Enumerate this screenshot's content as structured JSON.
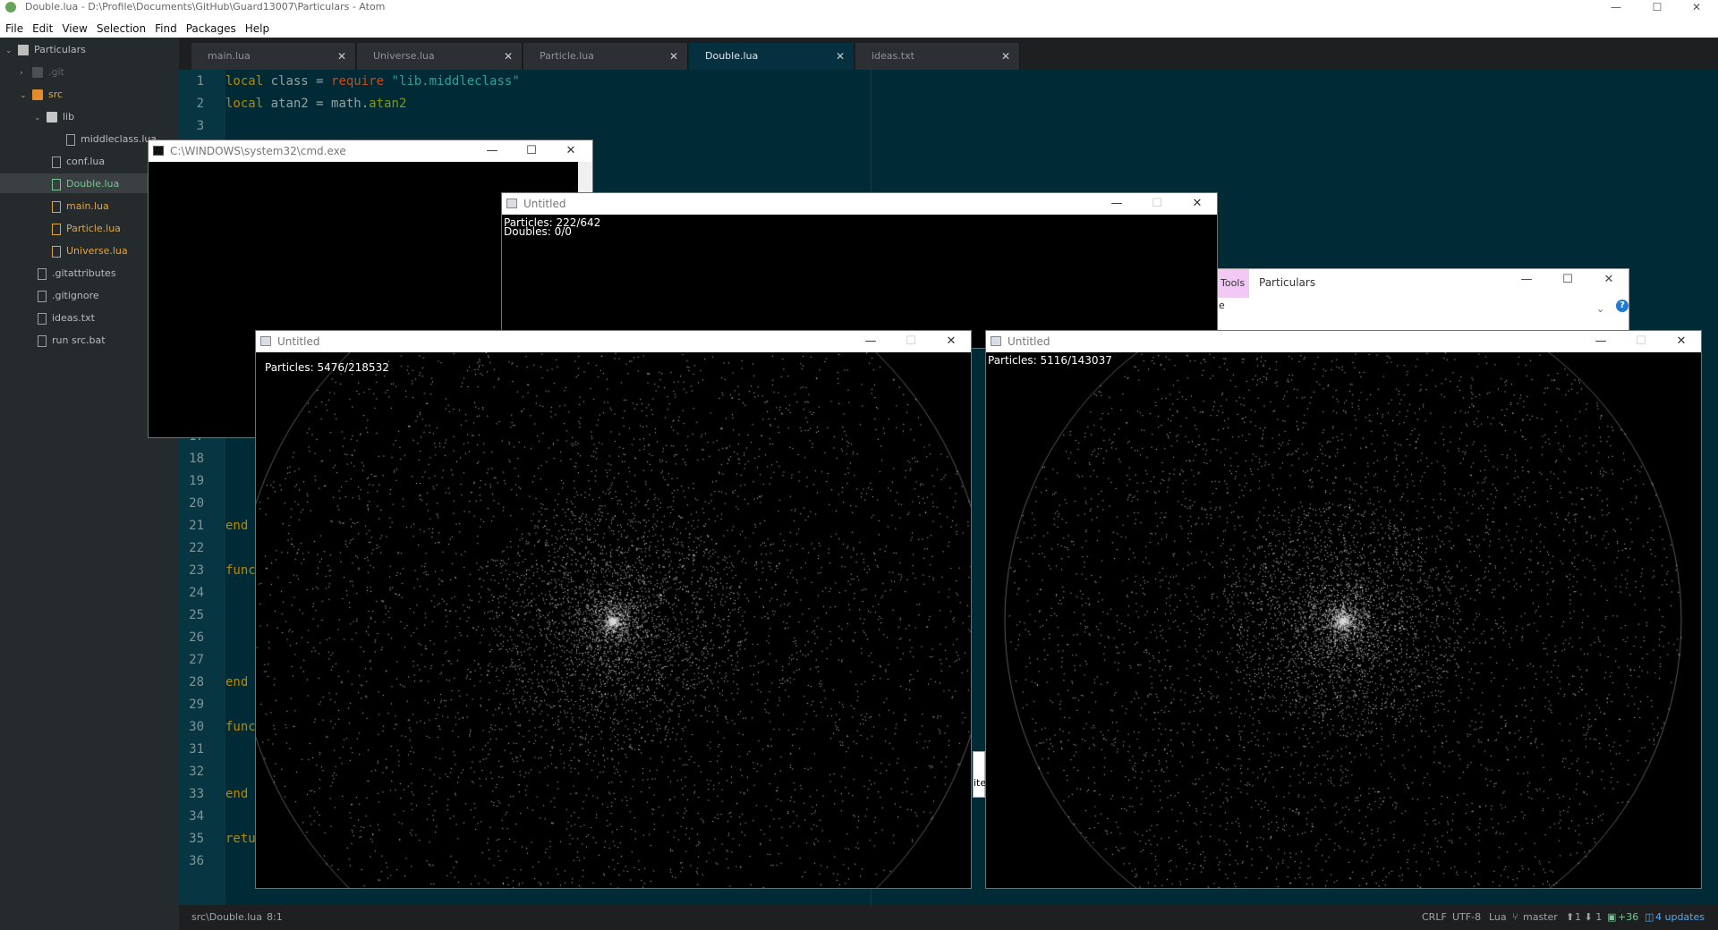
{
  "atom": {
    "title": "Double.lua - D:\\Profile\\Documents\\GitHub\\Guard13007\\Particulars - Atom",
    "window_controls": {
      "minimize": "—",
      "maximize": "☐",
      "close": "✕"
    },
    "menu": [
      "File",
      "Edit",
      "View",
      "Selection",
      "Find",
      "Packages",
      "Help"
    ]
  },
  "tree": {
    "root": "Particulars",
    "items": [
      {
        "label": ".git",
        "kind": "folder",
        "depth": 1,
        "caret": "›"
      },
      {
        "label": "src",
        "kind": "folder-open",
        "depth": 1,
        "caret": "⌄"
      },
      {
        "label": "lib",
        "kind": "folder-open",
        "depth": 2,
        "caret": "⌄"
      },
      {
        "label": "middleclass.lua",
        "kind": "file",
        "depth": 3
      },
      {
        "label": "conf.lua",
        "kind": "file",
        "depth": 2
      },
      {
        "label": "Double.lua",
        "kind": "file",
        "depth": 2,
        "status": "added"
      },
      {
        "label": "main.lua",
        "kind": "file",
        "depth": 2,
        "status": "modified"
      },
      {
        "label": "Particle.lua",
        "kind": "file",
        "depth": 2,
        "status": "modified"
      },
      {
        "label": "Universe.lua",
        "kind": "file",
        "depth": 2,
        "status": "modified"
      },
      {
        "label": ".gitattributes",
        "kind": "file",
        "depth": 1
      },
      {
        "label": ".gitignore",
        "kind": "file",
        "depth": 1
      },
      {
        "label": "ideas.txt",
        "kind": "file",
        "depth": 1
      },
      {
        "label": "run src.bat",
        "kind": "file",
        "depth": 1
      }
    ]
  },
  "tabs": [
    {
      "label": "main.lua",
      "close": "✕"
    },
    {
      "label": "Universe.lua",
      "close": "✕"
    },
    {
      "label": "Particle.lua",
      "close": "✕"
    },
    {
      "label": "Double.lua",
      "close": "✕",
      "active": true
    },
    {
      "label": "ideas.txt",
      "close": "✕"
    }
  ],
  "editor": {
    "line_numbers": [
      "1",
      "2",
      "3",
      "17",
      "18",
      "19",
      "20",
      "21",
      "22",
      "23",
      "24",
      "25",
      "26",
      "27",
      "28",
      "29",
      "30",
      "31",
      "32",
      "33",
      "34",
      "35",
      "36"
    ],
    "code": {
      "l1_local": "local",
      "l1_mid": " class = ",
      "l1_require": "require",
      "l1_str": " \"lib.middleclass\"",
      "l2_local": "local",
      "l2_mid": " atan2 = math.",
      "l2_fn": "atan2",
      "end": "end",
      "func": "func",
      "retu": "retu"
    }
  },
  "statusbar": {
    "path": "src\\Double.lua",
    "cursor": "8:1",
    "line_ending": "CRLF",
    "encoding": "UTF-8",
    "grammar": "Lua",
    "branch": "master",
    "ahead_behind": "1 ⬇ 1",
    "diff": "+36",
    "updates": "4 updates"
  },
  "cmd_window": {
    "title": "C:\\WINDOWS\\system32\\cmd.exe"
  },
  "love_windows": [
    {
      "title": "Untitled",
      "text": [
        "Particles: 222/642",
        "Doubles: 0/0"
      ]
    },
    {
      "title": "Untitled",
      "text": [
        "Particles: 5476/218532"
      ]
    },
    {
      "title": "Untitled",
      "text": [
        "Particles: 5116/143037"
      ]
    }
  ],
  "explorer": {
    "ribbon_tab": "Tools",
    "title": "Particulars",
    "partial_e": "e",
    "partial_ite": "ite"
  },
  "window_buttons": {
    "minimize": "—",
    "maximize": "☐",
    "close": "✕"
  },
  "colors": {
    "editor_bg": "#002b36",
    "added": "#73c990",
    "modified": "#e2a53f",
    "accent": "#1f7bd1"
  }
}
